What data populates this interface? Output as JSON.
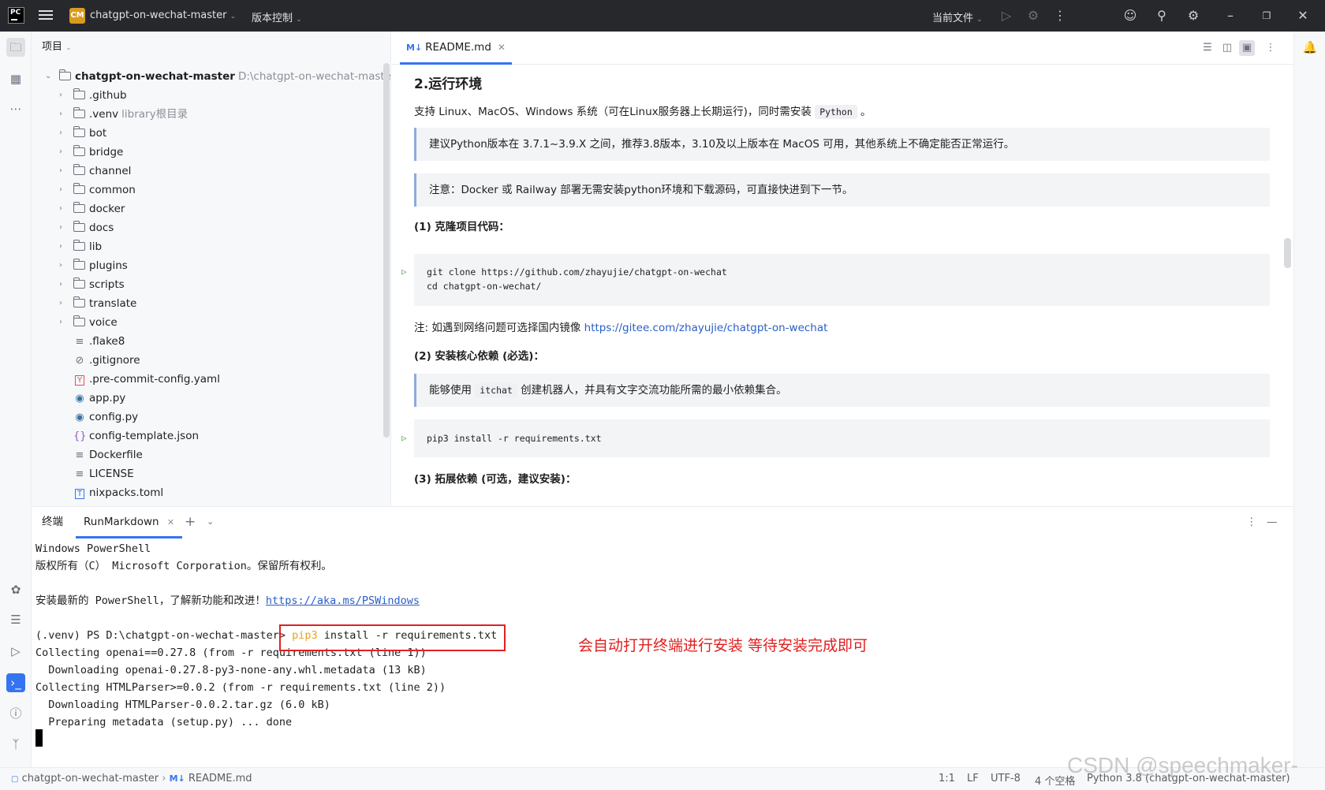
{
  "titlebar": {
    "logo_text": "PC",
    "project_badge": "CM",
    "project_name": "chatgpt-on-wechat-master",
    "vcs_menu": "版本控制",
    "run_config": "当前文件"
  },
  "project_panel": {
    "header": "项目",
    "root": {
      "name": "chatgpt-on-wechat-master",
      "path": "D:\\chatgpt-on-wechat-master"
    },
    "folders": [
      {
        "name": ".github",
        "note": ""
      },
      {
        "name": ".venv",
        "note": "library根目录"
      },
      {
        "name": "bot",
        "note": ""
      },
      {
        "name": "bridge",
        "note": ""
      },
      {
        "name": "channel",
        "note": ""
      },
      {
        "name": "common",
        "note": ""
      },
      {
        "name": "docker",
        "note": ""
      },
      {
        "name": "docs",
        "note": ""
      },
      {
        "name": "lib",
        "note": ""
      },
      {
        "name": "plugins",
        "note": ""
      },
      {
        "name": "scripts",
        "note": ""
      },
      {
        "name": "translate",
        "note": ""
      },
      {
        "name": "voice",
        "note": ""
      }
    ],
    "files": [
      {
        "name": ".flake8",
        "icon": "text-file-icon"
      },
      {
        "name": ".gitignore",
        "icon": "ignore-file-icon"
      },
      {
        "name": ".pre-commit-config.yaml",
        "icon": "yaml-file-icon"
      },
      {
        "name": "app.py",
        "icon": "python-file-icon"
      },
      {
        "name": "config.py",
        "icon": "python-file-icon"
      },
      {
        "name": "config-template.json",
        "icon": "json-file-icon"
      },
      {
        "name": "Dockerfile",
        "icon": "text-file-icon"
      },
      {
        "name": "LICENSE",
        "icon": "text-file-icon"
      },
      {
        "name": "nixpacks.toml",
        "icon": "toml-file-icon"
      }
    ]
  },
  "editor": {
    "tab_badge": "M↓",
    "tab_name": "README.md",
    "heading": "2.运行环境",
    "p1_pre": "支持 Linux、MacOS、Windows 系统（可在Linux服务器上长期运行)，同时需安装",
    "p1_code": "Python",
    "p1_post": "。",
    "quote1": "建议Python版本在 3.7.1~3.9.X 之间，推荐3.8版本，3.10及以上版本在 MacOS 可用，其他系统上不确定能否正常运行。",
    "quote2": "注意：Docker 或 Railway 部署无需安装python环境和下载源码，可直接快进到下一节。",
    "h_clone": "(1) 克隆项目代码：",
    "code1_line1": "git clone https://github.com/zhayujie/chatgpt-on-wechat",
    "code1_line2": "cd chatgpt-on-wechat/",
    "note_pre": "注: 如遇到网络问题可选择国内镜像",
    "note_link": "https://gitee.com/zhayujie/chatgpt-on-wechat",
    "h_deps": "(2) 安装核心依赖 (必选)：",
    "quote3_pre": "能够使用",
    "quote3_code": "itchat",
    "quote3_post": "创建机器人，并具有文字交流功能所需的最小依赖集合。",
    "code2": "pip3 install -r requirements.txt",
    "h_ext": "(3) 拓展依赖 (可选，建议安装)："
  },
  "terminal": {
    "tab_terminal": "终端",
    "tab_run": "RunMarkdown",
    "lines": {
      "l1": "Windows PowerShell",
      "l2": "版权所有（C） Microsoft Corporation。保留所有权利。",
      "l3_pre": "安装最新的 PowerShell，了解新功能和改进！",
      "l3_link": "https://aka.ms/PSWindows",
      "l4_prompt": "(.venv) PS D:\\chatgpt-on-wechat-master> ",
      "l4_pip": "pip3",
      "l4_rest": " install -r requirements.txt",
      "l5": "Collecting openai==0.27.8 (from -r requirements.txt (line 1))",
      "l6": "  Downloading openai-0.27.8-py3-none-any.whl.metadata (13 kB)",
      "l7": "Collecting HTMLParser>=0.0.2 (from -r requirements.txt (line 2))",
      "l8": "  Downloading HTMLParser-0.0.2.tar.gz (6.0 kB)",
      "l9": "  Preparing metadata (setup.py) ... done"
    },
    "annotation": "会自动打开终端进行安装 等待安装完成即可"
  },
  "statusbar": {
    "breadcrumb_project": "chatgpt-on-wechat-master",
    "breadcrumb_file": "README.md",
    "position": "1:1",
    "line_sep": "LF",
    "encoding": "UTF-8",
    "indent": "4 个空格",
    "interpreter": "Python 3.8 (chatgpt-on-wechat-master)"
  },
  "watermark": "CSDN @speechmaker-",
  "colors": {
    "accent": "#3574f0",
    "annotation_red": "#e02020",
    "titlebar_bg": "#27282c",
    "pip_orange": "#e8a31a"
  }
}
